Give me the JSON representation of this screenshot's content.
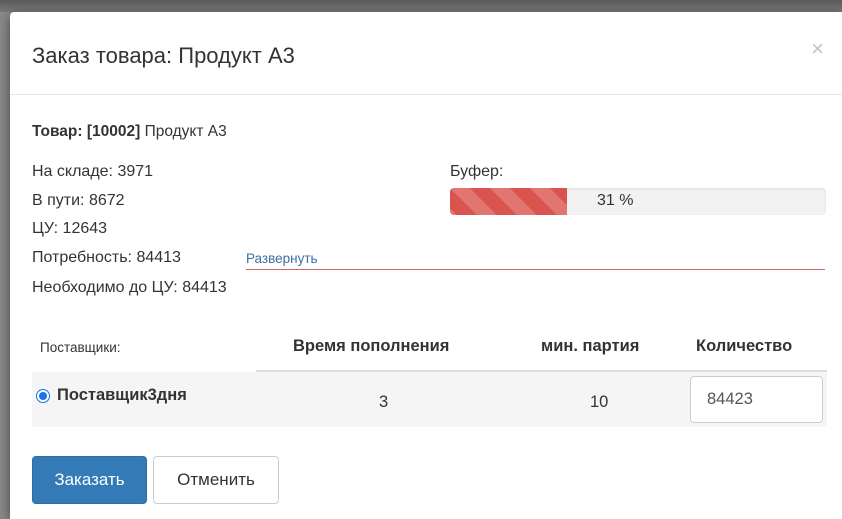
{
  "modal": {
    "title": "Заказ товара: Продукт А3",
    "close_label": "×"
  },
  "product": {
    "label": "Товар: [10002]",
    "name": "Продукт А3"
  },
  "stock": {
    "on_hand": "На складе: 3971",
    "in_transit": "В пути: 8672",
    "target": "ЦУ: 12643",
    "demand": "Потребность: 84413",
    "expand_link": "Развернуть",
    "needed": "Необходимо до ЦУ: 84413"
  },
  "buffer": {
    "label": "Буфер:",
    "percent_text": "31 %",
    "fill_fraction": 0.31,
    "color": "#d9534f"
  },
  "suppliers_table": {
    "headers": {
      "suppliers": "Поставщики:",
      "lead_time": "Время пополнения",
      "min_batch": "мин. партия",
      "quantity": "Количество"
    },
    "rows": [
      {
        "name": "Поставщик3дня",
        "selected": true,
        "lead_time": "3",
        "min_batch": "10",
        "quantity": "84423"
      }
    ]
  },
  "actions": {
    "order_label": "Заказать",
    "cancel_label": "Отменить",
    "primary_color": "#337ab7"
  }
}
